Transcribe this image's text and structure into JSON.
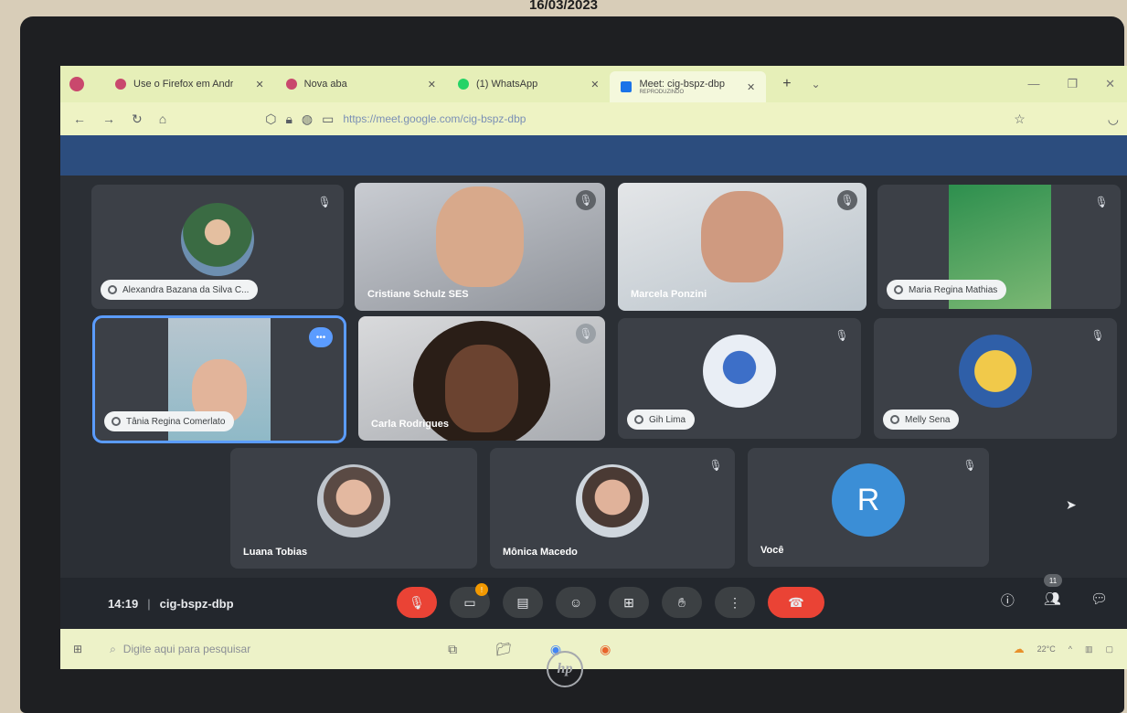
{
  "scan": {
    "date": "16/03/2023"
  },
  "browser": {
    "tabs": [
      {
        "title": "Use o Firefox em Andr",
        "favicon_color": "#c9486d",
        "active": false
      },
      {
        "title": "Nova aba",
        "favicon_color": "#c9486d",
        "active": false
      },
      {
        "title": "(1) WhatsApp",
        "favicon_color": "#25d366",
        "active": false
      },
      {
        "title": "Meet: cig-bspz-dbp",
        "favicon_color": "#1a73e8",
        "active": true,
        "subtitle": "REPRODUZINDO"
      }
    ],
    "url": "https://meet.google.com/cig-bspz-dbp"
  },
  "meet": {
    "participants": [
      {
        "name": "Alexandra Bazana da Silva C...",
        "style": "avatar",
        "muted": true
      },
      {
        "name": "Cristiane Schulz SES",
        "style": "video",
        "muted": true
      },
      {
        "name": "Marcela Ponzini",
        "style": "video",
        "muted": true
      },
      {
        "name": "Maria Regina Mathias",
        "style": "avatar",
        "muted": true
      },
      {
        "name": "Tânia Regina Comerlato",
        "style": "video",
        "speaking": true
      },
      {
        "name": "Carla Rodrigues",
        "style": "video",
        "muted": true
      },
      {
        "name": "Gih Lima",
        "style": "avatar",
        "muted": true
      },
      {
        "name": "Melly Sena",
        "style": "avatar",
        "muted": true
      },
      {
        "name": "Luana Tobias",
        "style": "avatar",
        "muted": false
      },
      {
        "name": "Mônica Macedo",
        "style": "avatar",
        "muted": true
      },
      {
        "name": "Você",
        "style": "letter",
        "letter": "R",
        "muted": true
      }
    ],
    "time": "14:19",
    "separator": "|",
    "meeting_code": "cig-bspz-dbp",
    "people_count": "11",
    "notification_badge": "!"
  },
  "taskbar": {
    "search_placeholder": "Digite aqui para pesquisar",
    "temperature": "22°C"
  },
  "monitor": {
    "brand": "hp"
  },
  "colors": {
    "accent_blue": "#5b9cff",
    "mic_off_red": "#ea4335",
    "tab_bar": "#e6efb8",
    "meet_bg": "#2b2f35"
  }
}
